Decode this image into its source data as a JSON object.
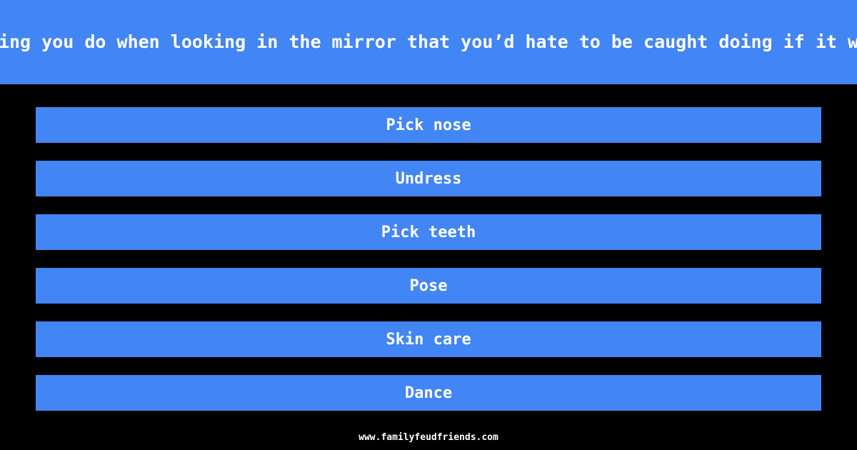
{
  "colors": {
    "background": "#000000",
    "accent_blue": "#4285F4",
    "text_white": "#FFFFFF"
  },
  "question": {
    "text": "Name something you do when looking in the mirror that you’d hate to be caught doing if it was recorded",
    "visible_fragment": "ou do when looking in the mirror that you’d hate to be caught doing if it wa"
  },
  "answers": [
    {
      "label": "Pick nose"
    },
    {
      "label": "Undress"
    },
    {
      "label": "Pick teeth"
    },
    {
      "label": "Pose"
    },
    {
      "label": "Skin care"
    },
    {
      "label": "Dance"
    }
  ],
  "footer": {
    "url": "www.familyfeudfriends.com"
  }
}
